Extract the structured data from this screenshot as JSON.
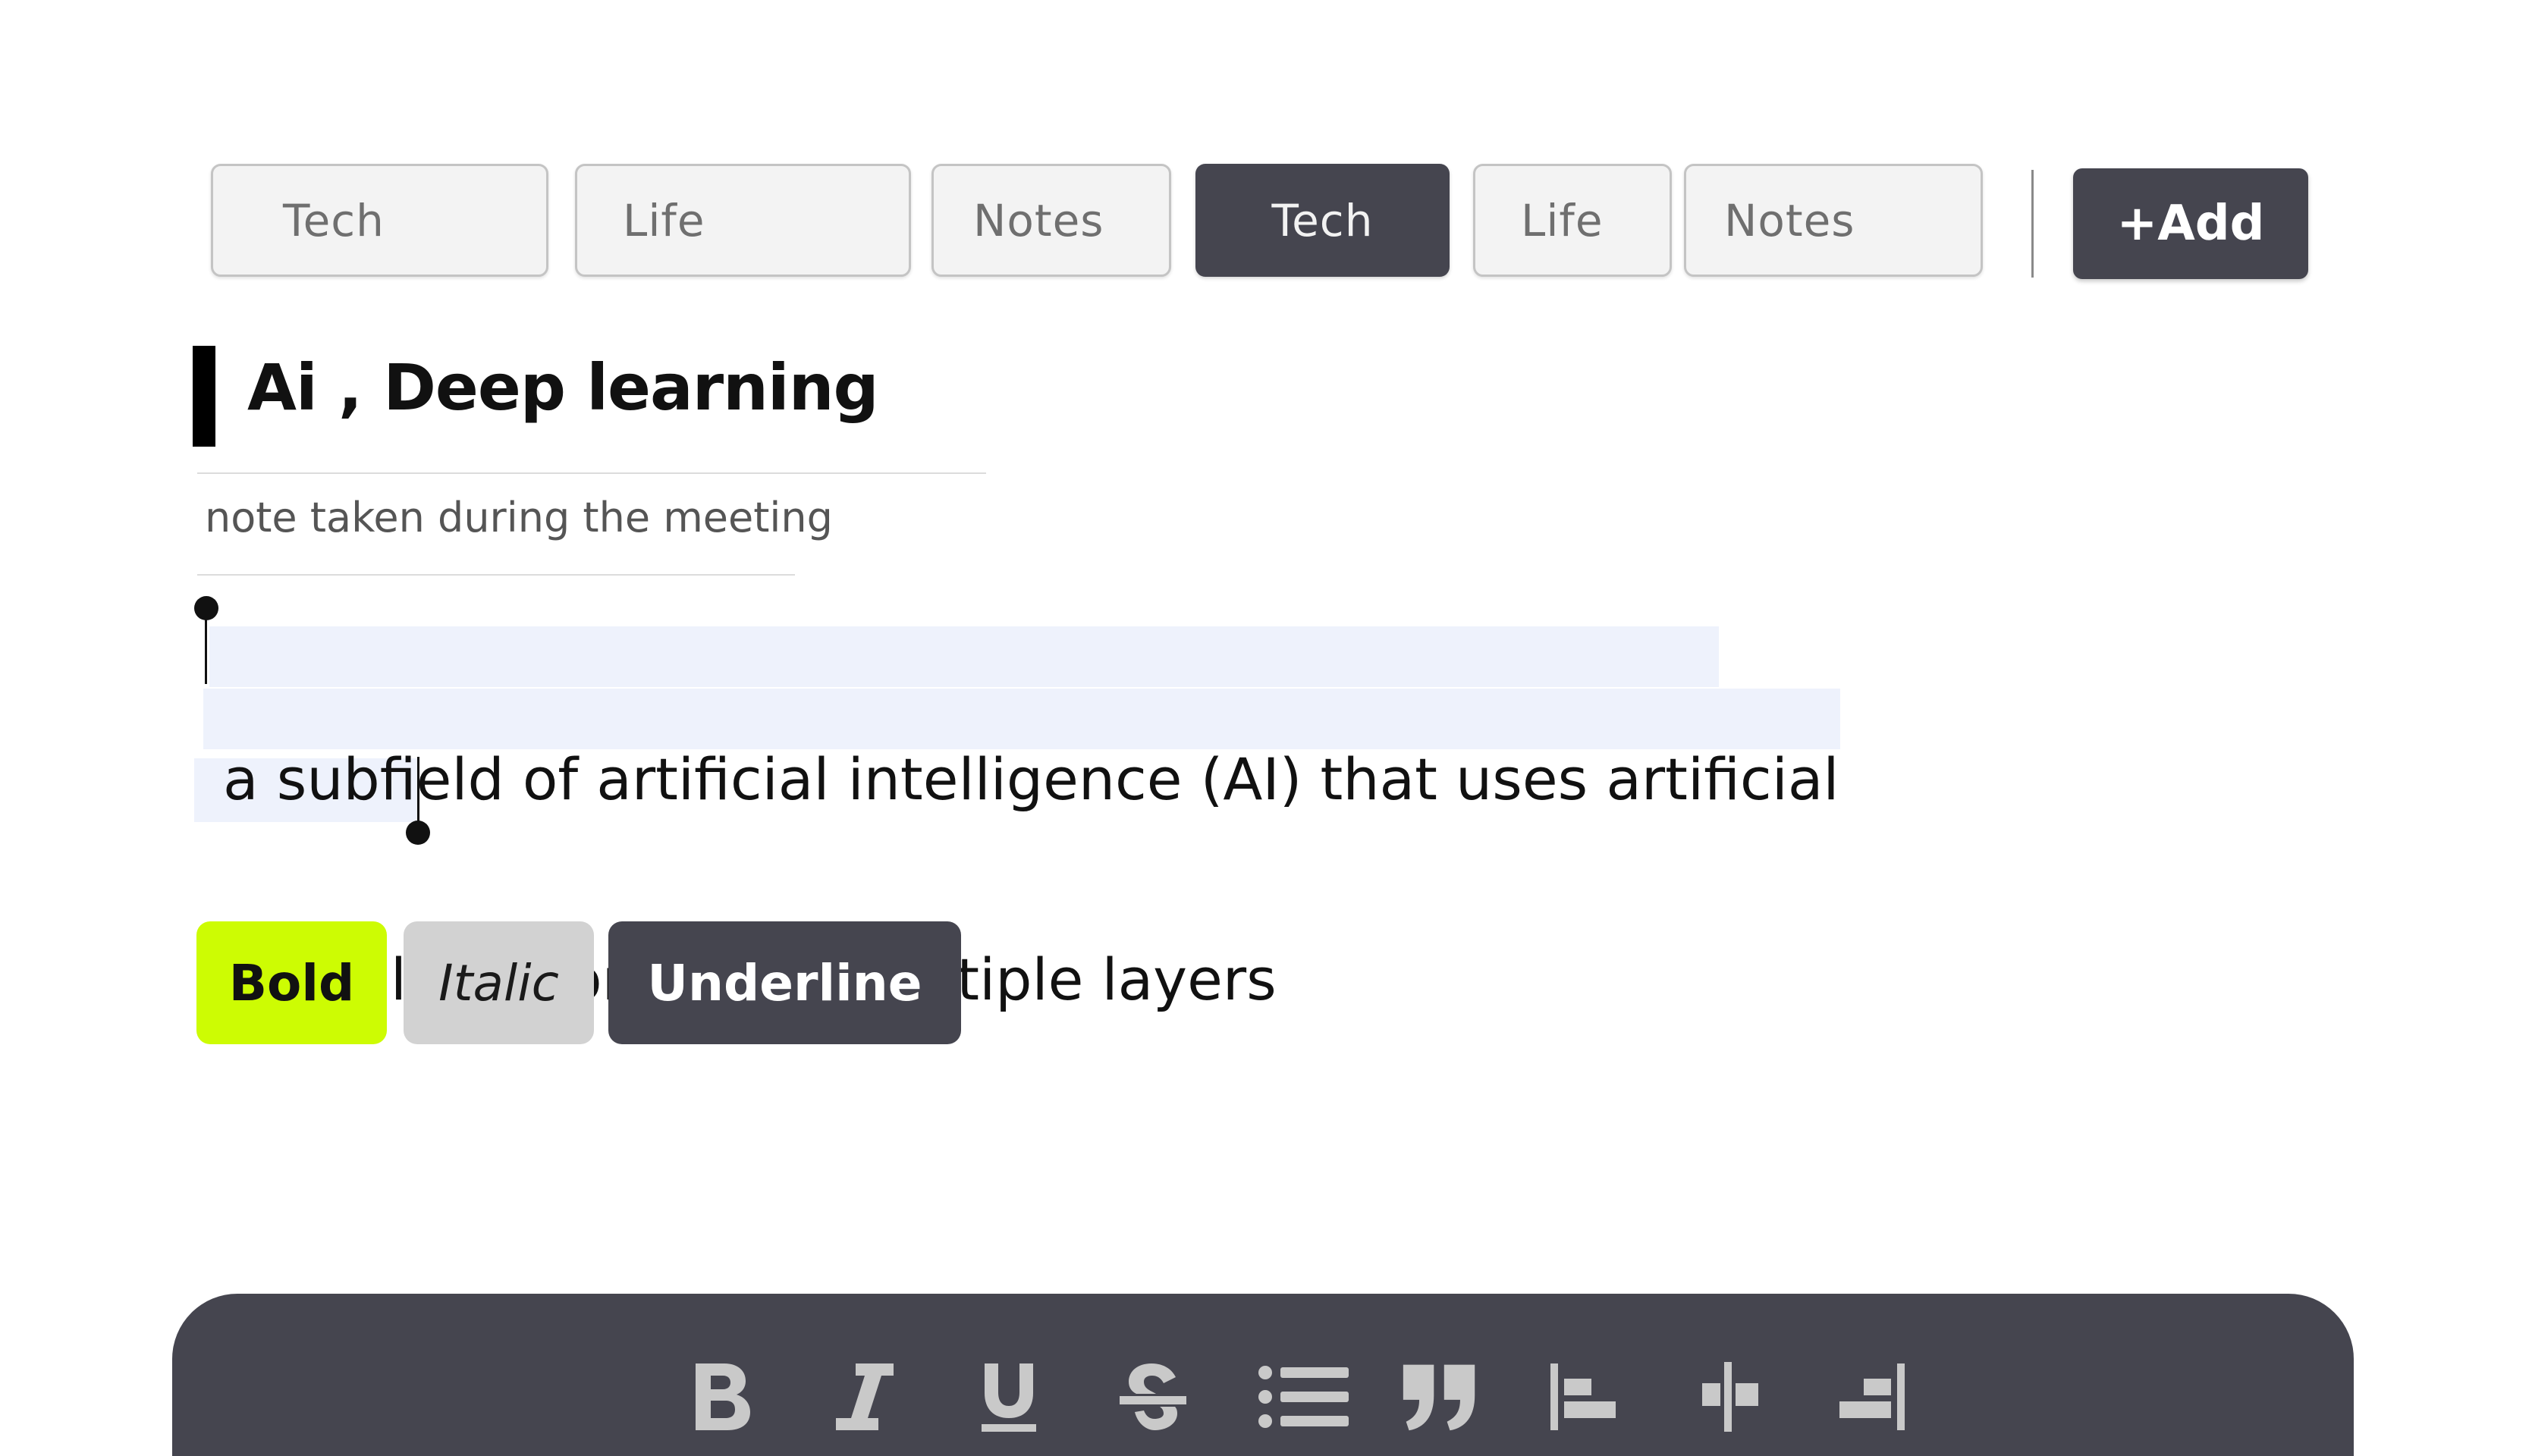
{
  "tags": [
    {
      "label": "Tech",
      "active": false
    },
    {
      "label": "Life",
      "active": false
    },
    {
      "label": "Notes",
      "active": false
    },
    {
      "label": "Tech",
      "active": true
    },
    {
      "label": "Life",
      "active": false
    },
    {
      "label": "Notes",
      "active": false
    }
  ],
  "add_button": {
    "label": "+Add"
  },
  "note": {
    "title": "Ai , Deep learning",
    "subtitle": "note taken during the meeting",
    "body_line_1": "a subfield of artificial intelligence (AI) that uses artificial",
    "body_line_2": "neural networks with multiple layers",
    "selection": "entire body text selected"
  },
  "style_buttons": {
    "bold": "Bold",
    "italic": "Italic",
    "underline": "Underline"
  },
  "toolbar": {
    "icons": [
      "bold-icon",
      "italic-icon",
      "underline-icon",
      "strikethrough-icon",
      "bullet-list-icon",
      "quote-icon",
      "align-left-icon",
      "align-center-icon",
      "align-right-icon"
    ]
  },
  "colors": {
    "accent_dark": "#45454f",
    "accent_lime": "#cdfc03",
    "selection": "#eef2fc",
    "icon_gray": "#c9c9c9"
  }
}
